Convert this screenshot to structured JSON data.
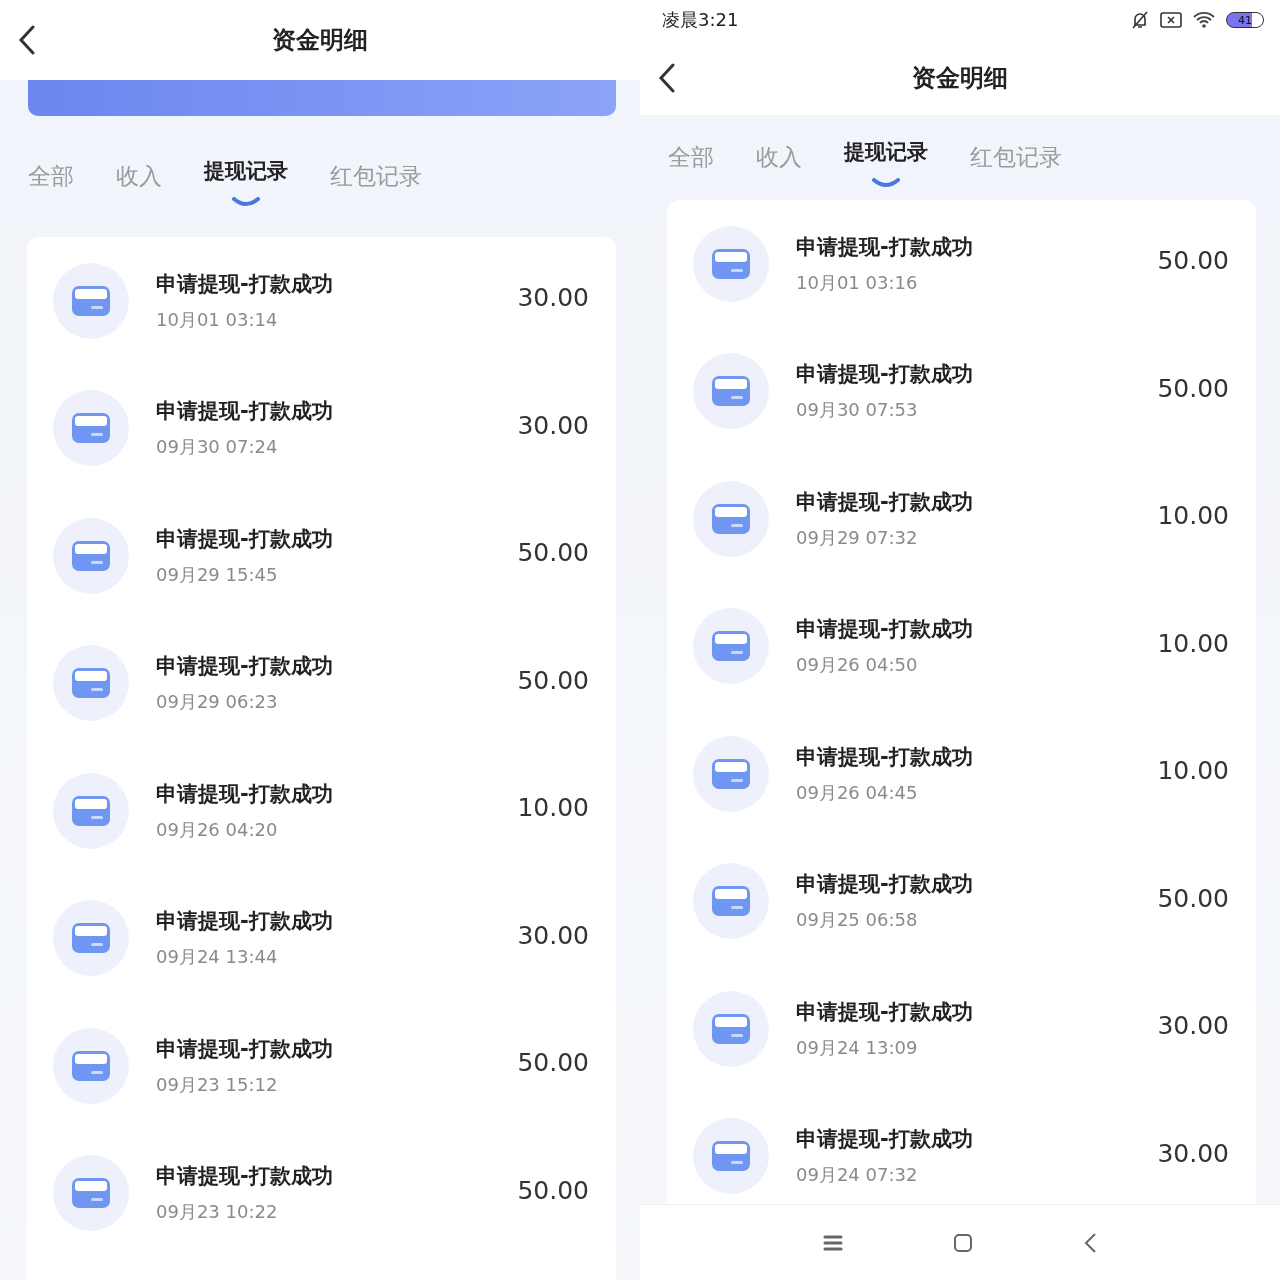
{
  "panels": [
    {
      "header": {
        "title": "资金明细"
      },
      "banner_peek": true,
      "tabs": [
        {
          "label": "全部",
          "selected": false
        },
        {
          "label": "收入",
          "selected": false
        },
        {
          "label": "提现记录",
          "selected": true
        },
        {
          "label": "红包记录",
          "selected": false
        }
      ],
      "records": [
        {
          "title": "申请提现-打款成功",
          "time": "10月01 03:14",
          "amount": "30.00"
        },
        {
          "title": "申请提现-打款成功",
          "time": "09月30 07:24",
          "amount": "30.00"
        },
        {
          "title": "申请提现-打款成功",
          "time": "09月29 15:45",
          "amount": "50.00"
        },
        {
          "title": "申请提现-打款成功",
          "time": "09月29 06:23",
          "amount": "50.00"
        },
        {
          "title": "申请提现-打款成功",
          "time": "09月26 04:20",
          "amount": "10.00"
        },
        {
          "title": "申请提现-打款成功",
          "time": "09月24 13:44",
          "amount": "30.00"
        },
        {
          "title": "申请提现-打款成功",
          "time": "09月23 15:12",
          "amount": "50.00"
        },
        {
          "title": "申请提现-打款成功",
          "time": "09月23 10:22",
          "amount": "50.00"
        }
      ]
    },
    {
      "status_bar": {
        "time": "凌晨3:21",
        "battery": "41"
      },
      "header": {
        "title": "资金明细"
      },
      "tabs": [
        {
          "label": "全部",
          "selected": false
        },
        {
          "label": "收入",
          "selected": false
        },
        {
          "label": "提现记录",
          "selected": true
        },
        {
          "label": "红包记录",
          "selected": false
        }
      ],
      "records": [
        {
          "title": "申请提现-打款成功",
          "time": "10月01 03:16",
          "amount": "50.00"
        },
        {
          "title": "申请提现-打款成功",
          "time": "09月30 07:53",
          "amount": "50.00"
        },
        {
          "title": "申请提现-打款成功",
          "time": "09月29 07:32",
          "amount": "10.00"
        },
        {
          "title": "申请提现-打款成功",
          "time": "09月26 04:50",
          "amount": "10.00"
        },
        {
          "title": "申请提现-打款成功",
          "time": "09月26 04:45",
          "amount": "10.00"
        },
        {
          "title": "申请提现-打款成功",
          "time": "09月25 06:58",
          "amount": "50.00"
        },
        {
          "title": "申请提现-打款成功",
          "time": "09月24 13:09",
          "amount": "30.00"
        },
        {
          "title": "申请提现-打款成功",
          "time": "09月24 07:32",
          "amount": "30.00"
        }
      ],
      "nav_bar": true
    }
  ]
}
